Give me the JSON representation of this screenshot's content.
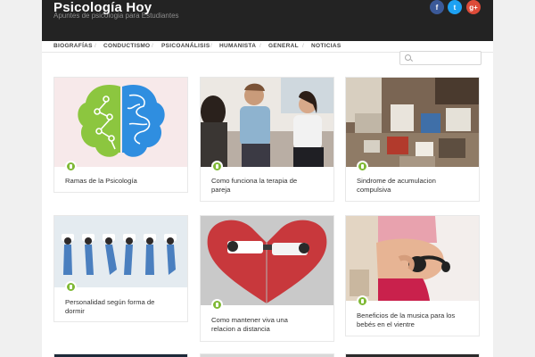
{
  "header": {
    "title": "Psicología Hoy",
    "tagline": "Apuntes de psicologia para Estudiantes"
  },
  "social": {
    "facebook": "f",
    "twitter": "t",
    "googleplus": "g+"
  },
  "nav": {
    "items": [
      "BIOGRAFÍAS",
      "CONDUCTISMO",
      "PSICOANÁLISIS",
      "HUMANISTA",
      "GENERAL",
      "NOTICIAS"
    ]
  },
  "search": {
    "placeholder": "",
    "value": ""
  },
  "posts": [
    {
      "title_line1": "Ramas de la Psicología",
      "title_line2": ""
    },
    {
      "title_line1": "Como funciona la terapia de",
      "title_line2": "pareja"
    },
    {
      "title_line1": "Sindrome de acumulacion",
      "title_line2": "compulsiva"
    },
    {
      "title_line1": "Personalidad según forma de",
      "title_line2": "dormir"
    },
    {
      "title_line1": "Como mantener viva una",
      "title_line2": "relacion a distancia"
    },
    {
      "title_line1": "Beneficios de la musica para los",
      "title_line2": "bebés en el vientre"
    }
  ],
  "colors": {
    "header_bg": "#232323",
    "accent": "#7fb935"
  }
}
